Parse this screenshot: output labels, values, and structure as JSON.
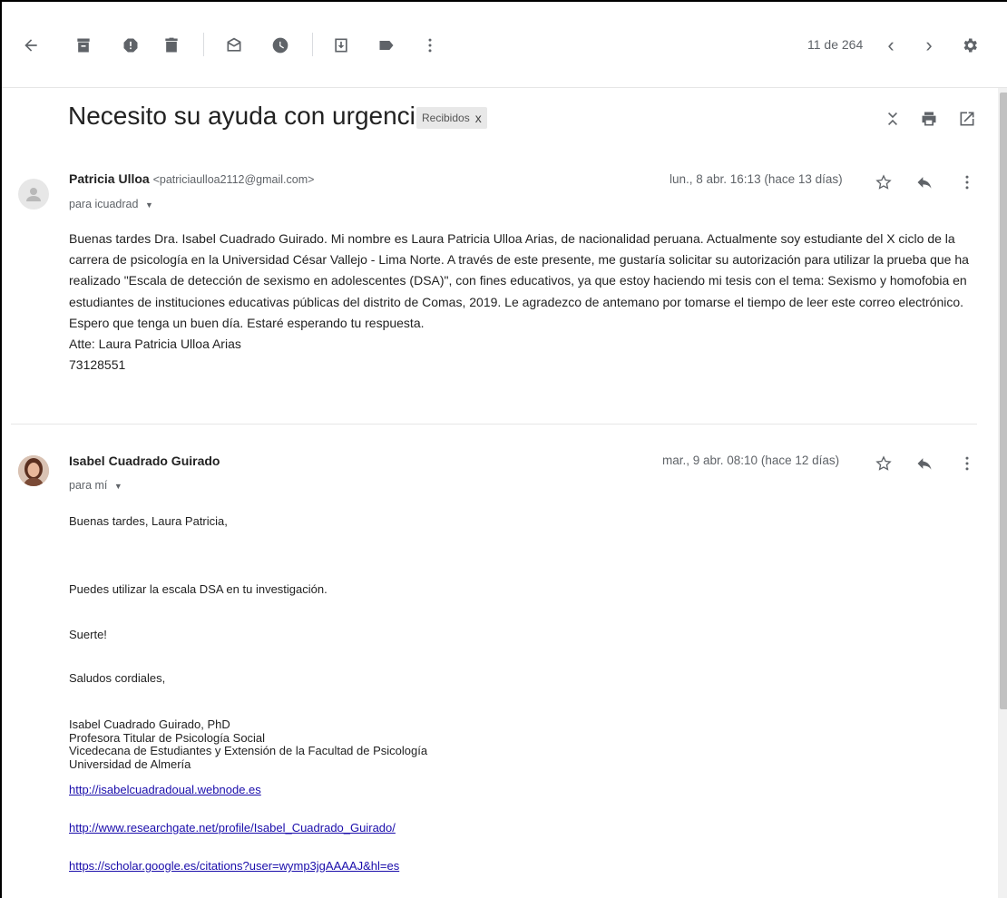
{
  "toolbar": {
    "icons": [
      "back-arrow-icon",
      "archive-icon",
      "report-spam-icon",
      "delete-icon",
      "mark-unread-icon",
      "snooze-icon",
      "move-to-icon",
      "label-icon",
      "more-vert-icon"
    ],
    "pager_text": "11 de 264",
    "prev_glyph": "‹",
    "next_glyph": "›"
  },
  "thread": {
    "subject": "Necesito su ayuda con urgencia.",
    "label": "Recibidos",
    "label_remove": "x"
  },
  "message1": {
    "sender_name": "Patricia Ulloa",
    "sender_email": "<patriciaulloa2112@gmail.com>",
    "recipient": "para icuadrad",
    "date": "lun., 8 abr. 16:13 (hace 13 días)",
    "body": "Buenas tardes Dra. Isabel Cuadrado Guirado. Mi nombre es Laura Patricia Ulloa Arias, de nacionalidad peruana. Actualmente soy estudiante del X ciclo de la carrera de psicología en la Universidad César Vallejo - Lima Norte. A través de este presente, me gustaría solicitar su autorización para utilizar la prueba que ha realizado \"Escala de detección de sexismo en adolescentes (DSA)\", con fines educativos, ya que estoy haciendo mi tesis con el tema: Sexismo y homofobia en estudiantes de instituciones educativas públicas del distrito de Comas, 2019. Le agradezco de antemano por tomarse el tiempo de leer este correo electrónico. Espero que tenga un buen día. Estaré esperando tu respuesta.",
    "signoff": "Atte: Laura Patricia Ulloa Arias",
    "phone": "73128551"
  },
  "message2": {
    "sender_name": "Isabel Cuadrado Guirado",
    "recipient": "para mí",
    "date": "mar., 9 abr. 08:10 (hace 12 días)",
    "greeting": "Buenas tardes, Laura Patricia,",
    "line1": "Puedes utilizar la escala DSA en tu investigación.",
    "line2": "Suerte!",
    "line3": "Saludos cordiales,",
    "signature": [
      "Isabel Cuadrado Guirado, PhD",
      "Profesora Titular de Psicología Social",
      "Vicedecana de Estudiantes y Extensión de la Facultad de Psicología",
      "Universidad de Almería"
    ],
    "links": [
      "http://isabelcuadradoual.webnode.es",
      "http://www.researchgate.net/profile/Isabel_Cuadrado_Guirado/",
      "https://scholar.google.es/citations?user=wymp3jgAAAAJ&hl=es"
    ]
  },
  "colors": {
    "icon": "#5f6368",
    "link": "#1a0dab",
    "label_chip": "#e8e8e8"
  }
}
